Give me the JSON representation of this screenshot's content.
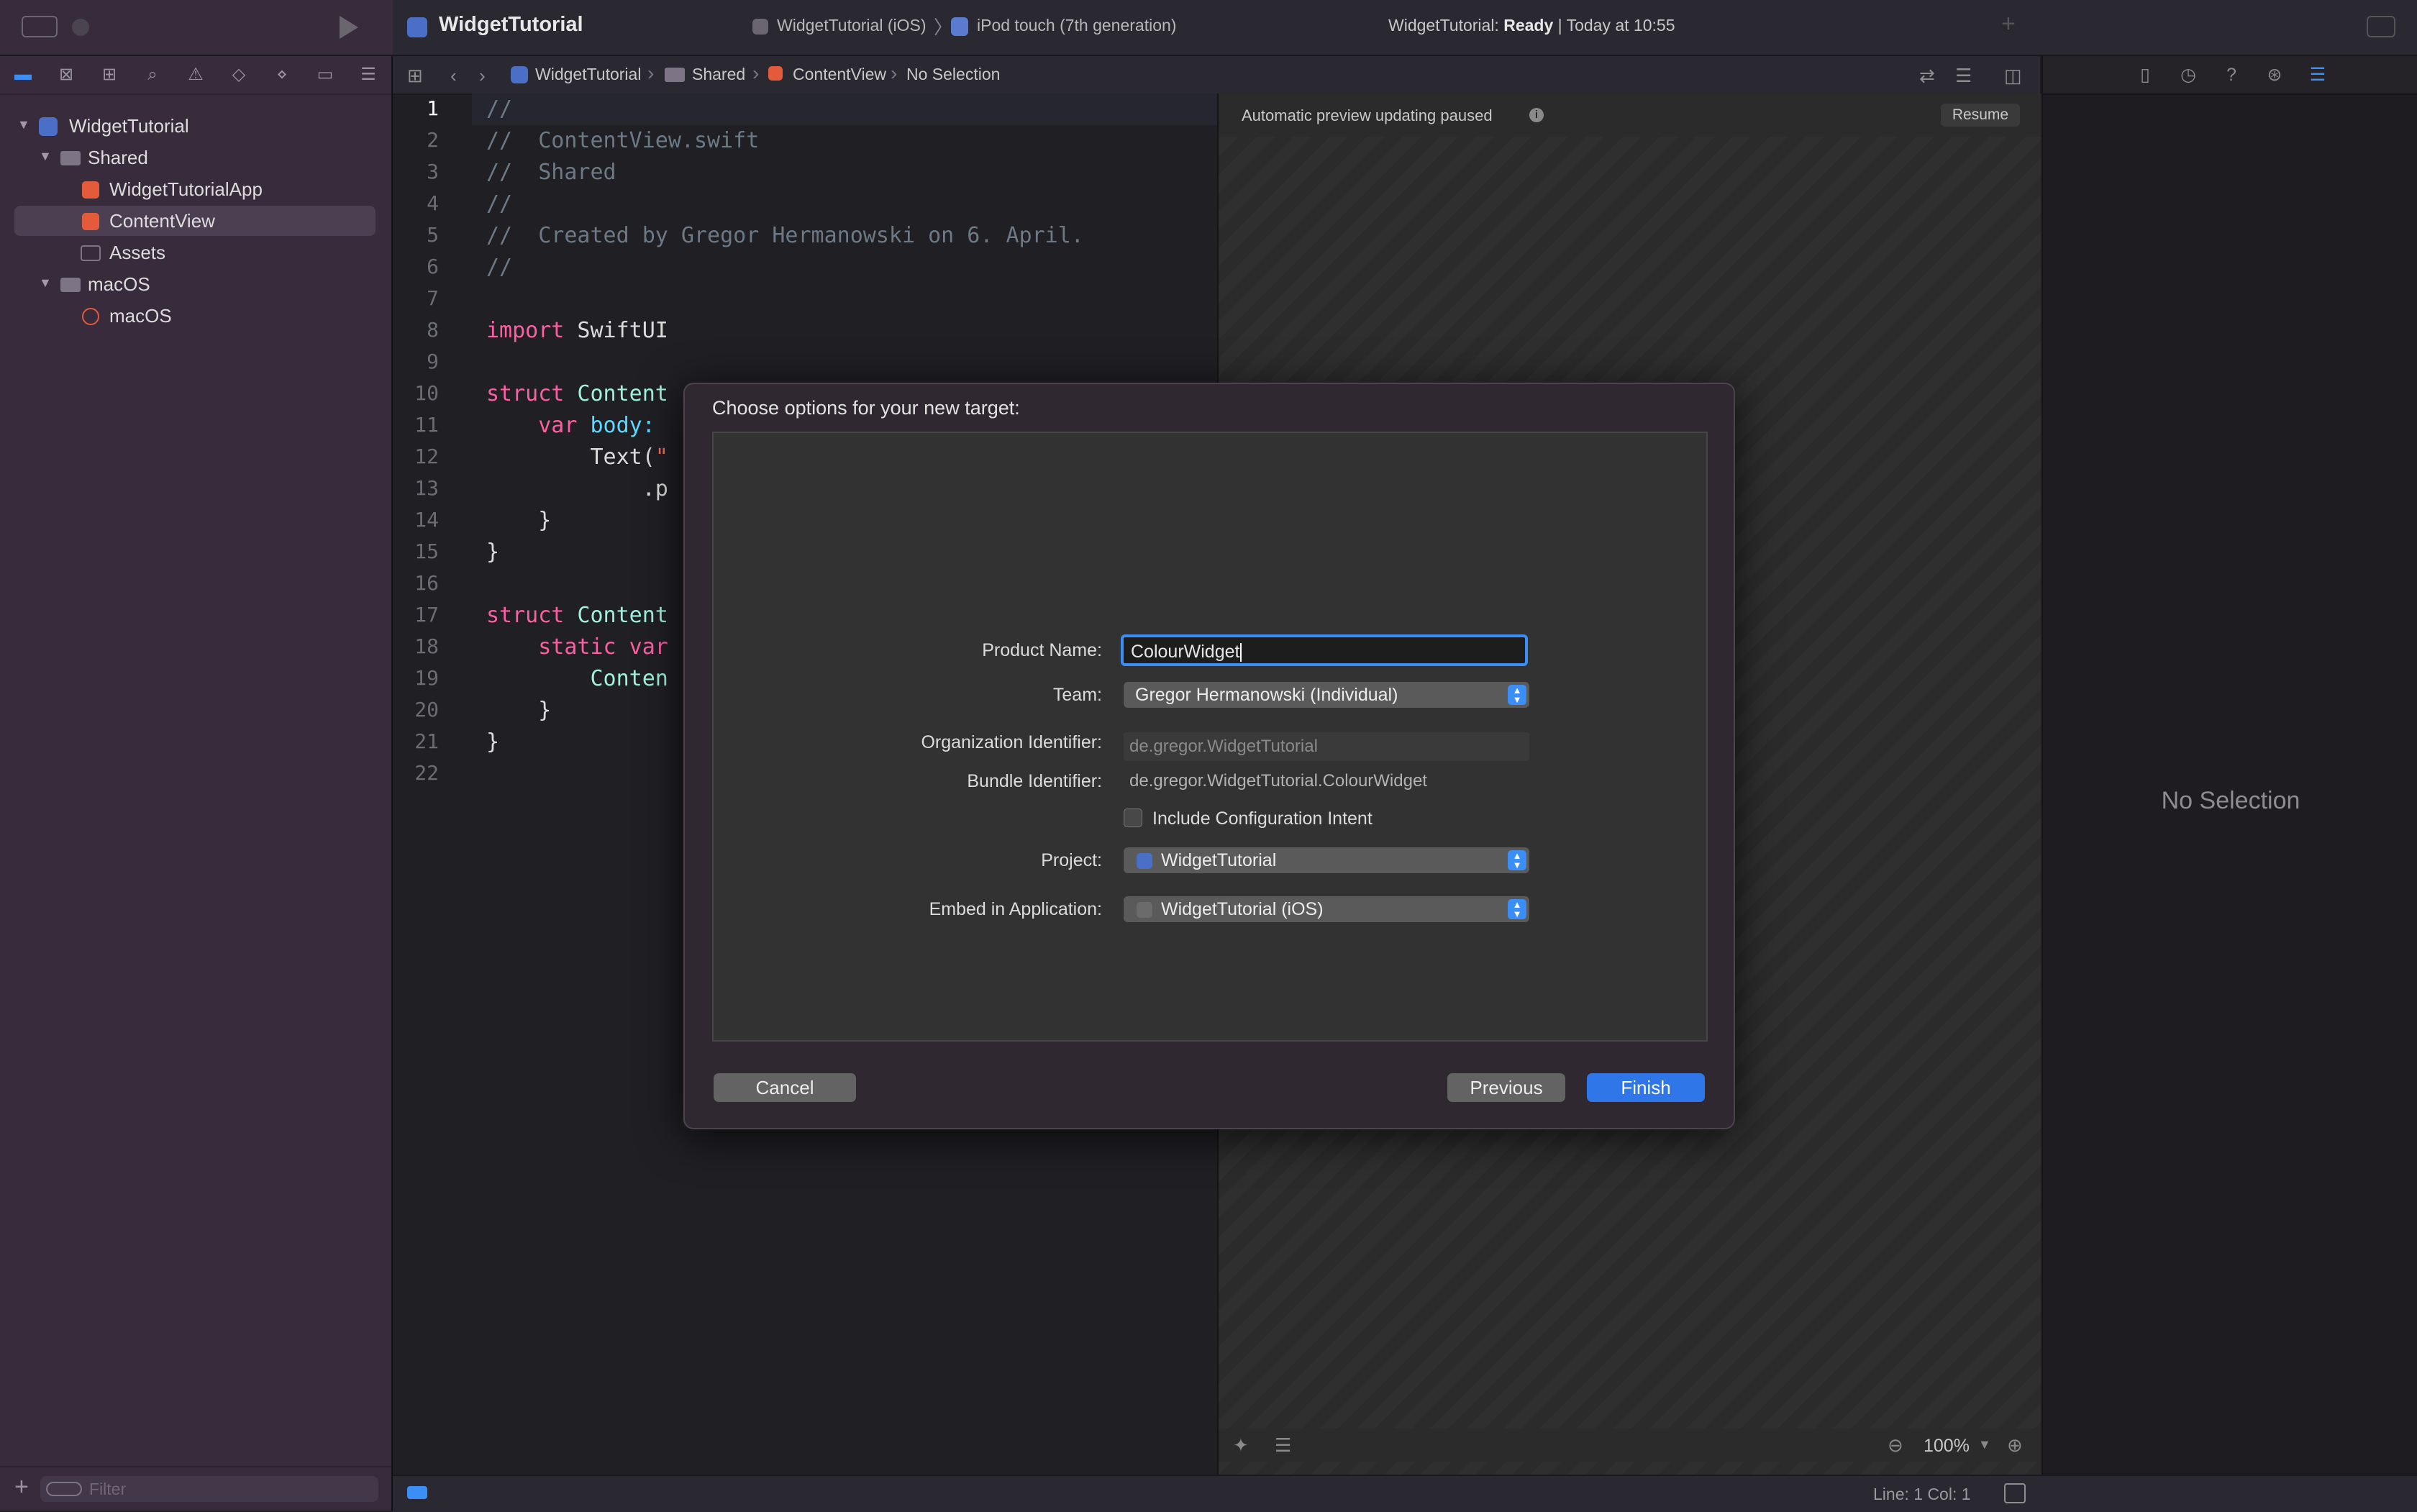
{
  "toolbar": {
    "project_title": "WidgetTutorial",
    "scheme": "WidgetTutorial (iOS)",
    "separator": "〉",
    "device": "iPod touch (7th generation)",
    "status_prefix": "WidgetTutorial:",
    "status_state": "Ready",
    "status_suffix": "| Today at 10:55"
  },
  "navigator": {
    "tree": [
      {
        "label": "WidgetTutorial",
        "kind": "project"
      },
      {
        "label": "Shared",
        "kind": "folder"
      },
      {
        "label": "WidgetTutorialApp",
        "kind": "swift"
      },
      {
        "label": "ContentView",
        "kind": "swift",
        "selected": true
      },
      {
        "label": "Assets",
        "kind": "assets"
      },
      {
        "label": "macOS",
        "kind": "folder"
      },
      {
        "label": "macOS",
        "kind": "entitlements"
      }
    ],
    "filter_placeholder": "Filter"
  },
  "jumpbar": {
    "project": "WidgetTutorial",
    "folder": "Shared",
    "file": "ContentView",
    "symbol": "No Selection"
  },
  "editor": {
    "line_numbers": [
      "1",
      "2",
      "3",
      "4",
      "5",
      "6",
      "7",
      "8",
      "9",
      "10",
      "11",
      "12",
      "13",
      "14",
      "15",
      "16",
      "17",
      "18",
      "19",
      "20",
      "21",
      "22"
    ],
    "current_line": "1",
    "code": {
      "l1": "//",
      "l2": "//  ContentView.swift",
      "l3": "//  Shared",
      "l4": "//",
      "l5": "//  Created by Gregor Hermanowski on 6. April.",
      "l6": "//",
      "l8_kw": "import",
      "l8_ty": " SwiftUI",
      "l10_kw": "struct",
      "l10_ty": " Content",
      "l11_kw": "    var",
      "l11_pl": " body:",
      "l12_pl": "        Text(",
      "l12_st": "\"",
      "l13_pl": "            .p",
      "l14_pl": "    }",
      "l15_pl": "}",
      "l17_kw": "struct",
      "l17_ty": " Content",
      "l18_kw": "    static var",
      "l19_ty": "        Conten",
      "l20_pl": "    }",
      "l21_pl": "}"
    }
  },
  "canvas": {
    "message": "Automatic preview updating paused",
    "info_glyph": "i",
    "resume_label": "Resume",
    "zoom": "100%"
  },
  "inspector": {
    "empty_label": "No Selection"
  },
  "status_bar": {
    "line_col": "Line: 1  Col: 1"
  },
  "dialog": {
    "title": "Choose options for your new target:",
    "product_name_label": "Product Name:",
    "product_name_value": "ColourWidget",
    "team_label": "Team:",
    "team_value": "Gregor Hermanowski (Individual)",
    "org_label": "Organization Identifier:",
    "org_value": "de.gregor.WidgetTutorial",
    "bundle_label": "Bundle Identifier:",
    "bundle_value": "de.gregor.WidgetTutorial.ColourWidget",
    "intent_label": "Include Configuration Intent",
    "intent_checked": false,
    "project_label": "Project:",
    "project_value": "WidgetTutorial",
    "embed_label": "Embed in Application:",
    "embed_value": "WidgetTutorial (iOS)",
    "cancel": "Cancel",
    "previous": "Previous",
    "finish": "Finish"
  },
  "colors": {
    "accent": "#3b8ef6",
    "sidebar": "#382b3b",
    "finish_button": "#2f77e8"
  }
}
